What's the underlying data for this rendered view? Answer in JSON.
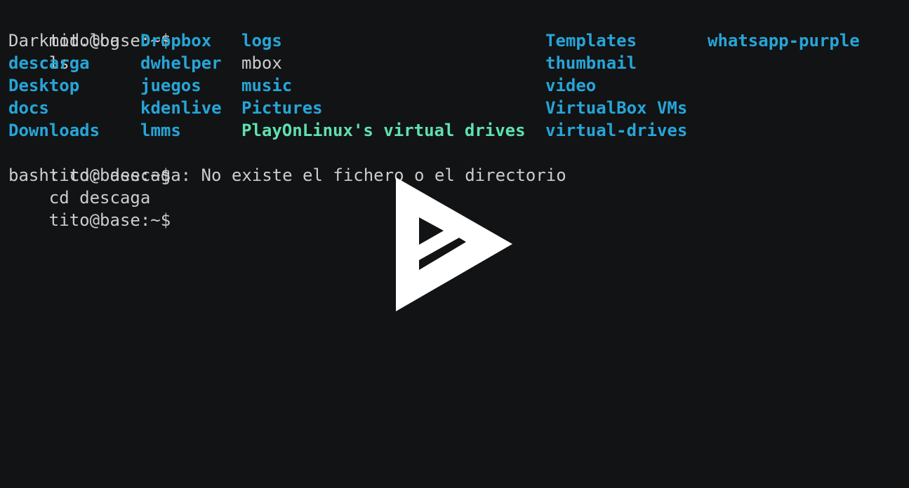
{
  "prompt": "tito@base:~$",
  "commands": {
    "ls": "ls",
    "cd": "cd descaga"
  },
  "ls_output": [
    [
      {
        "name": "Darkmod.log",
        "kind": "file"
      },
      {
        "name": "Dropbox",
        "kind": "dir"
      },
      {
        "name": "logs",
        "kind": "dir"
      },
      {
        "name": "Templates",
        "kind": "dir"
      },
      {
        "name": "whatsapp-purple",
        "kind": "dir"
      }
    ],
    [
      {
        "name": "descarga",
        "kind": "dir"
      },
      {
        "name": "dwhelper",
        "kind": "dir"
      },
      {
        "name": "mbox",
        "kind": "file"
      },
      {
        "name": "thumbnail",
        "kind": "dir"
      }
    ],
    [
      {
        "name": "Desktop",
        "kind": "dir"
      },
      {
        "name": "juegos",
        "kind": "dir"
      },
      {
        "name": "music",
        "kind": "dir"
      },
      {
        "name": "video",
        "kind": "dir"
      }
    ],
    [
      {
        "name": "docs",
        "kind": "dir"
      },
      {
        "name": "kdenlive",
        "kind": "dir"
      },
      {
        "name": "Pictures",
        "kind": "dir"
      },
      {
        "name": "VirtualBox VMs",
        "kind": "dir"
      }
    ],
    [
      {
        "name": "Downloads",
        "kind": "dir"
      },
      {
        "name": "lmms",
        "kind": "dir"
      },
      {
        "name": "PlayOnLinux's virtual drives",
        "kind": "exec"
      },
      {
        "name": "virtual-drives",
        "kind": "dir"
      }
    ]
  ],
  "error_message": "bash: cd: descaga: No existe el fichero o el directorio",
  "overlay_icon": "play-logo-icon",
  "colors": {
    "background": "#121314",
    "text": "#cccccc",
    "directory": "#26a5d8",
    "executable": "#5fe0b0",
    "overlay": "#ffffff"
  }
}
